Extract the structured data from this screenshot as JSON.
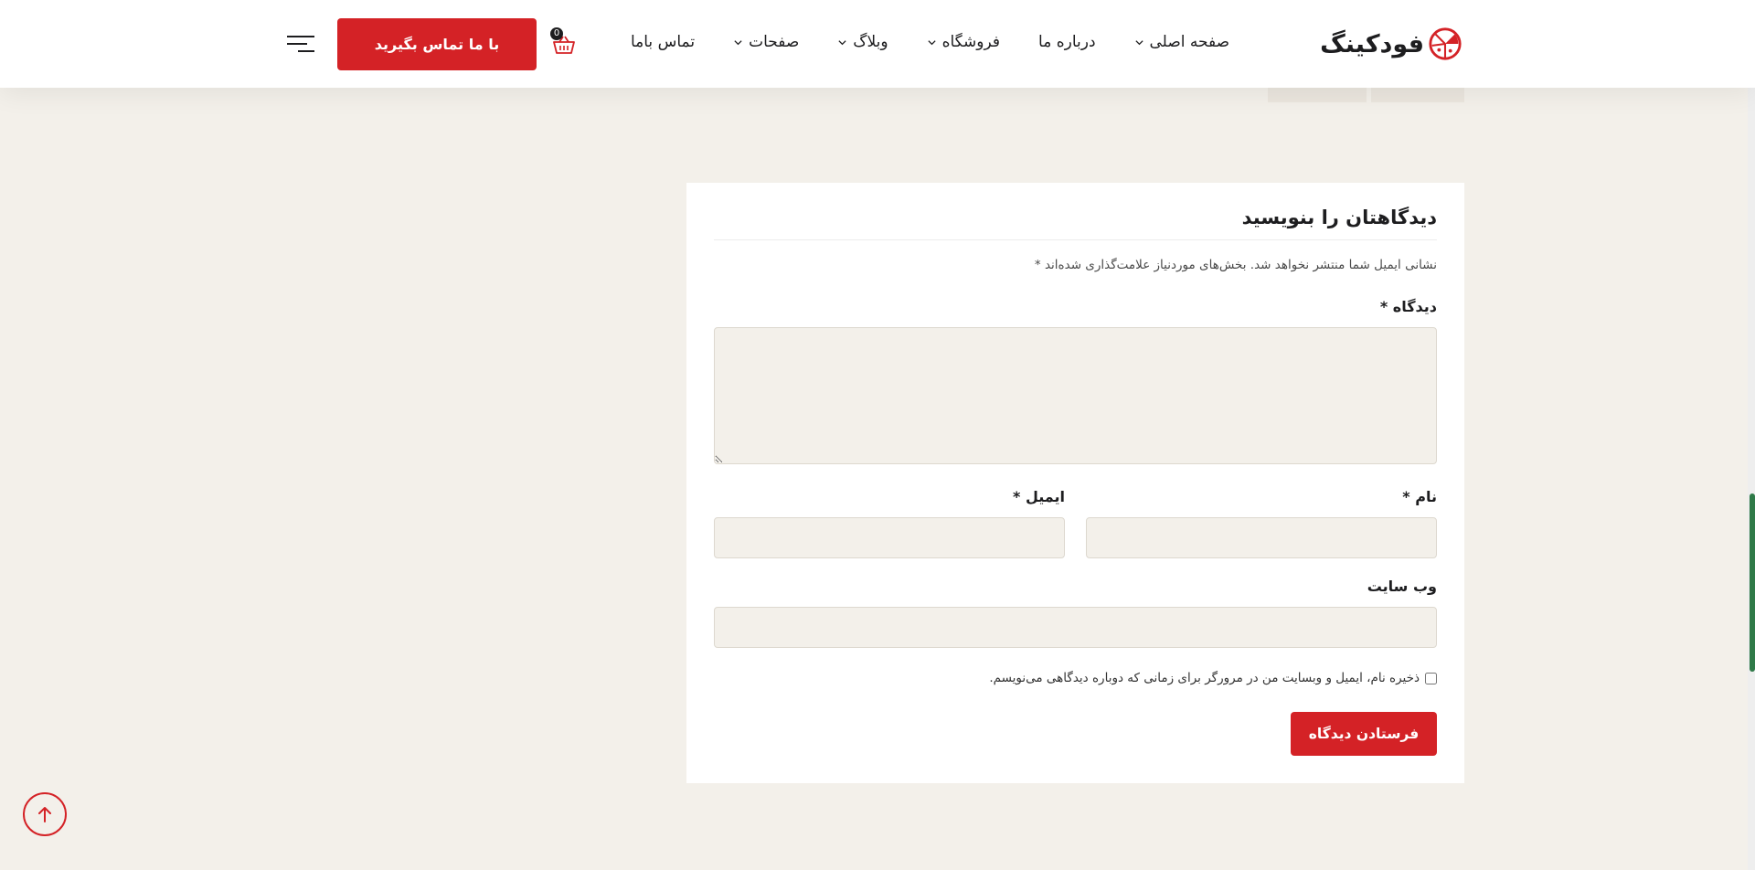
{
  "header": {
    "logo_text": "فودکینگ",
    "nav": {
      "home": "صفحه اصلی",
      "about": "درباره ما",
      "shop": "فروشگاه",
      "blog": "وبلاگ",
      "pages": "صفحات",
      "contact": "تماس باما"
    },
    "cart_count": "0",
    "cta_label": "با ما تماس بگیرید"
  },
  "form": {
    "title": "دیدگاهتان را بنویسید",
    "notice": "نشانی ایمیل شما منتشر نخواهد شد. بخش‌های موردنیاز علامت‌گذاری شده‌اند *",
    "comment_label": "دیدگاه",
    "name_label": "نام",
    "email_label": "ایمیل",
    "website_label": "وب سایت",
    "required_mark": "*",
    "consent_label": "ذخیره نام، ایمیل و وبسایت من در مرورگر برای زمانی که دوباره دیدگاهی می‌نویسم.",
    "submit_label": "فرستادن دیدگاه"
  },
  "colors": {
    "accent": "#d42226",
    "page_background": "#f3f0ea",
    "input_background": "#f3f0ea",
    "card_background": "#ffffff",
    "text": "#1d1d1f",
    "scrollbar_thumb": "#2f7a48"
  },
  "icons": {
    "logo": "pizza-slice-icon",
    "nav_dropdown": "chevron-down-icon",
    "cart": "shopping-basket-icon",
    "menu": "hamburger-menu-icon",
    "scroll_top": "arrow-up-icon"
  }
}
